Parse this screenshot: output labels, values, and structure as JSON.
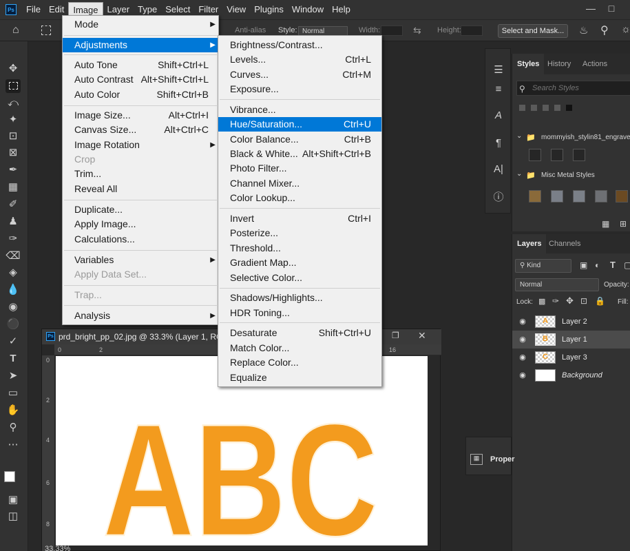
{
  "app": {
    "logo": "Ps"
  },
  "menubar": {
    "items": [
      "File",
      "Edit",
      "Image",
      "Layer",
      "Type",
      "Select",
      "Filter",
      "View",
      "Plugins",
      "Window",
      "Help"
    ],
    "active": "Image"
  },
  "options_bar": {
    "anti_alias": "Anti-alias",
    "style_label": "Style:",
    "style_value": "Normal",
    "width_label": "Width:",
    "height_label": "Height:",
    "select_and_mask": "Select and Mask..."
  },
  "image_menu": {
    "mode": "Mode",
    "adjustments": "Adjustments",
    "auto_tone": {
      "label": "Auto Tone",
      "shortcut": "Shift+Ctrl+L"
    },
    "auto_contrast": {
      "label": "Auto Contrast",
      "shortcut": "Alt+Shift+Ctrl+L"
    },
    "auto_color": {
      "label": "Auto Color",
      "shortcut": "Shift+Ctrl+B"
    },
    "image_size": {
      "label": "Image Size...",
      "shortcut": "Alt+Ctrl+I"
    },
    "canvas_size": {
      "label": "Canvas Size...",
      "shortcut": "Alt+Ctrl+C"
    },
    "image_rotation": "Image Rotation",
    "crop": "Crop",
    "trim": "Trim...",
    "reveal_all": "Reveal All",
    "duplicate": "Duplicate...",
    "apply_image": "Apply Image...",
    "calculations": "Calculations...",
    "variables": "Variables",
    "apply_data_set": "Apply Data Set...",
    "trap": "Trap...",
    "analysis": "Analysis"
  },
  "adjustments_menu": {
    "brightness_contrast": {
      "label": "Brightness/Contrast..."
    },
    "levels": {
      "label": "Levels...",
      "shortcut": "Ctrl+L"
    },
    "curves": {
      "label": "Curves...",
      "shortcut": "Ctrl+M"
    },
    "exposure": {
      "label": "Exposure..."
    },
    "vibrance": {
      "label": "Vibrance..."
    },
    "hue_saturation": {
      "label": "Hue/Saturation...",
      "shortcut": "Ctrl+U"
    },
    "color_balance": {
      "label": "Color Balance...",
      "shortcut": "Ctrl+B"
    },
    "black_white": {
      "label": "Black & White...",
      "shortcut": "Alt+Shift+Ctrl+B"
    },
    "photo_filter": {
      "label": "Photo Filter..."
    },
    "channel_mixer": {
      "label": "Channel Mixer..."
    },
    "color_lookup": {
      "label": "Color Lookup..."
    },
    "invert": {
      "label": "Invert",
      "shortcut": "Ctrl+I"
    },
    "posterize": {
      "label": "Posterize..."
    },
    "threshold": {
      "label": "Threshold..."
    },
    "gradient_map": {
      "label": "Gradient Map..."
    },
    "selective_color": {
      "label": "Selective Color..."
    },
    "shadows_highlights": {
      "label": "Shadows/Highlights..."
    },
    "hdr_toning": {
      "label": "HDR Toning..."
    },
    "desaturate": {
      "label": "Desaturate",
      "shortcut": "Shift+Ctrl+U"
    },
    "match_color": {
      "label": "Match Color..."
    },
    "replace_color": {
      "label": "Replace Color..."
    },
    "equalize": {
      "label": "Equalize"
    }
  },
  "document": {
    "title": "prd_bright_pp_02.jpg @ 33.3% (Layer 1, RGB/8",
    "status": "33.33%",
    "canvas_text": "ABC",
    "ruler_h": [
      "0",
      "2",
      "16"
    ],
    "ruler_v": [
      "0",
      "2",
      "4",
      "6",
      "8"
    ]
  },
  "styles_panel": {
    "tabs": [
      "Styles",
      "History",
      "Actions"
    ],
    "search_placeholder": "Search Styles",
    "group1": "mommyish_stylin81_engraved",
    "group2": "Misc Metal Styles"
  },
  "layers_panel": {
    "tabs": [
      "Layers",
      "Channels"
    ],
    "filter_kind": "Kind",
    "blend_mode": "Normal",
    "opacity_label": "Opacity:",
    "lock_label": "Lock:",
    "fill_label": "Fill:",
    "layers": [
      {
        "name": "Layer 2",
        "thumb": "A"
      },
      {
        "name": "Layer 1",
        "thumb": "B"
      },
      {
        "name": "Layer 3",
        "thumb": "C"
      },
      {
        "name": "Background",
        "thumb": ""
      }
    ]
  },
  "properties_panel": {
    "label": "Proper"
  },
  "colors": {
    "accent": "#0078d7",
    "letter_fill": "#f39b1e"
  }
}
